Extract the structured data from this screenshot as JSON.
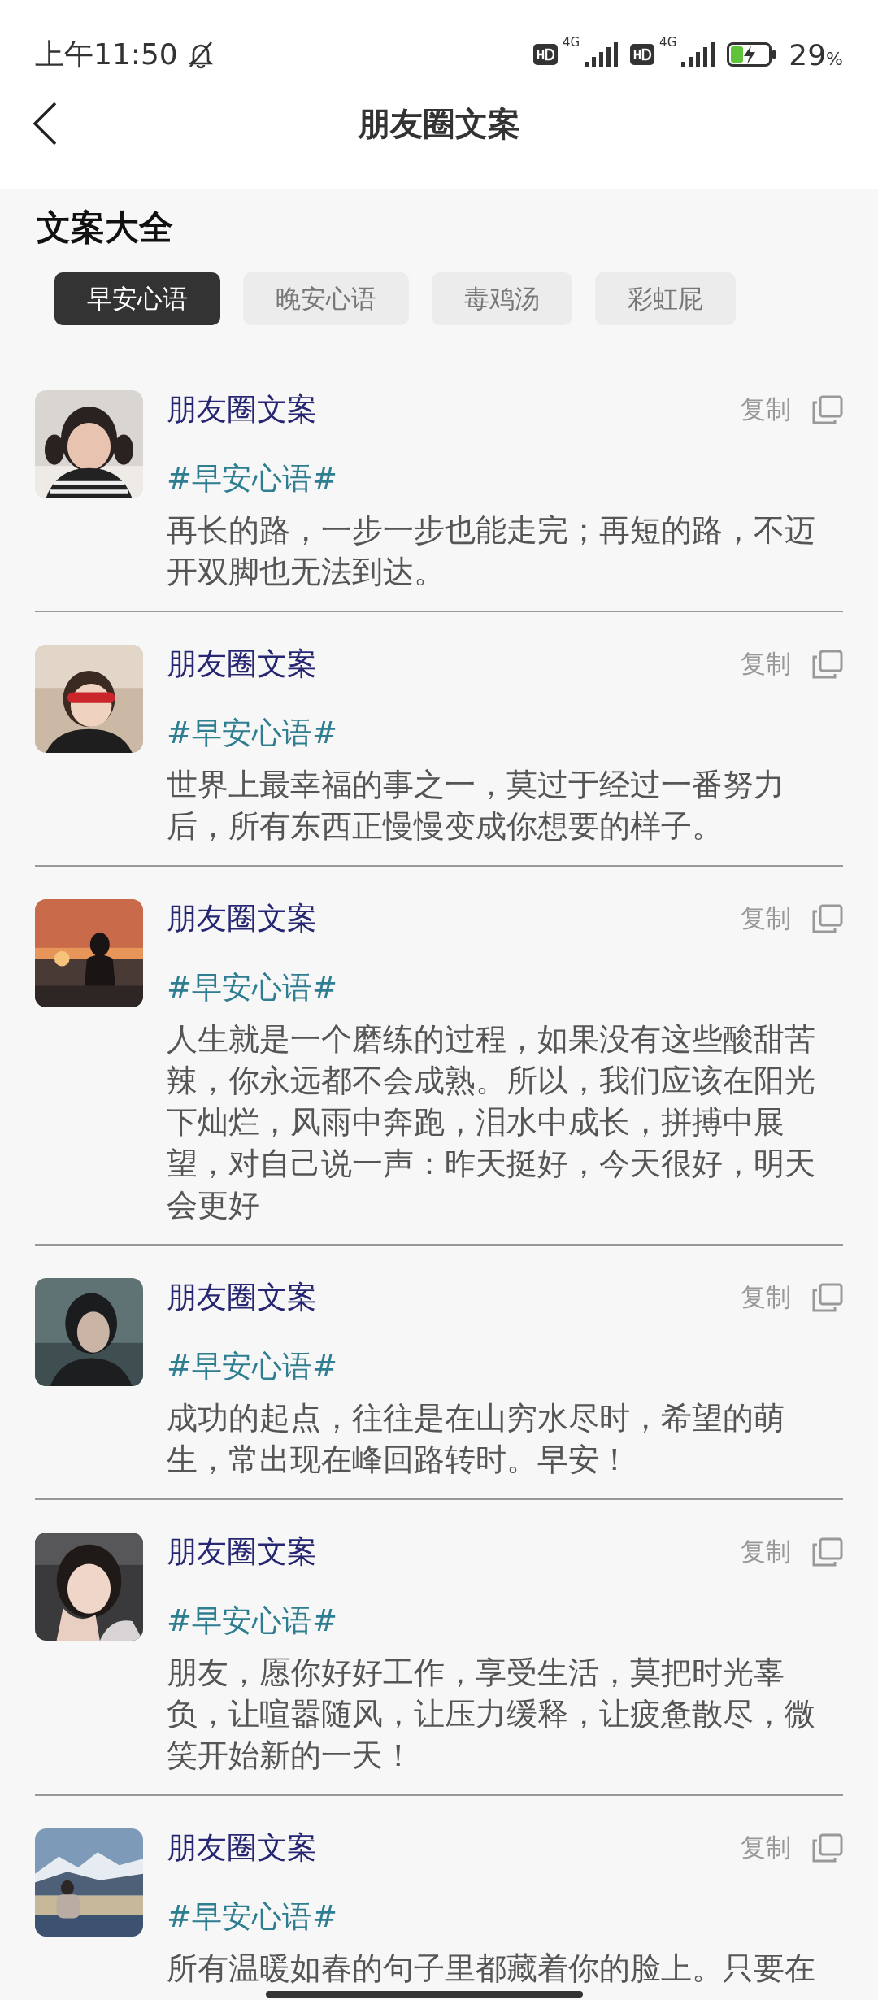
{
  "status_bar": {
    "time": "上午11:50",
    "sims": [
      {
        "network": "4G"
      },
      {
        "network": "4G"
      }
    ],
    "battery": "29",
    "battery_unit": "%"
  },
  "header": {
    "title": "朋友圈文案"
  },
  "section": {
    "title": "文案大全"
  },
  "tabs": [
    {
      "label": "早安心语",
      "selected": true
    },
    {
      "label": "晚安心语",
      "selected": false
    },
    {
      "label": "毒鸡汤",
      "selected": false
    },
    {
      "label": "彩虹屁",
      "selected": false
    }
  ],
  "posts": [
    {
      "name": "朋友圈文案",
      "copy": "复制",
      "tag": "#早安心语#",
      "text": "再长的路，一步一步也能走完；再短的路，不迈开双脚也无法到达。"
    },
    {
      "name": "朋友圈文案",
      "copy": "复制",
      "tag": "#早安心语#",
      "text": "世界上最幸福的事之一，莫过于经过一番努力后，所有东西正慢慢变成你想要的样子。"
    },
    {
      "name": "朋友圈文案",
      "copy": "复制",
      "tag": "#早安心语#",
      "text": "人生就是一个磨练的过程，如果没有这些酸甜苦辣，你永远都不会成熟。所以，我们应该在阳光下灿烂，风雨中奔跑，泪水中成长，拼搏中展望，对自己说一声：昨天挺好，今天很好，明天会更好"
    },
    {
      "name": "朋友圈文案",
      "copy": "复制",
      "tag": "#早安心语#",
      "text": "成功的起点，往往是在山穷水尽时，希望的萌生，常出现在峰回路转时。早安！"
    },
    {
      "name": "朋友圈文案",
      "copy": "复制",
      "tag": "#早安心语#",
      "text": "朋友，愿你好好工作，享受生活，莫把时光辜负，让喧嚣随风，让压力缓释，让疲惫散尽，微笑开始新的一天！"
    },
    {
      "name": "朋友圈文案",
      "copy": "复制",
      "tag": "#早安心语#",
      "text": "所有温暖如春的句子里都藏着你的脸上。只要在"
    }
  ]
}
